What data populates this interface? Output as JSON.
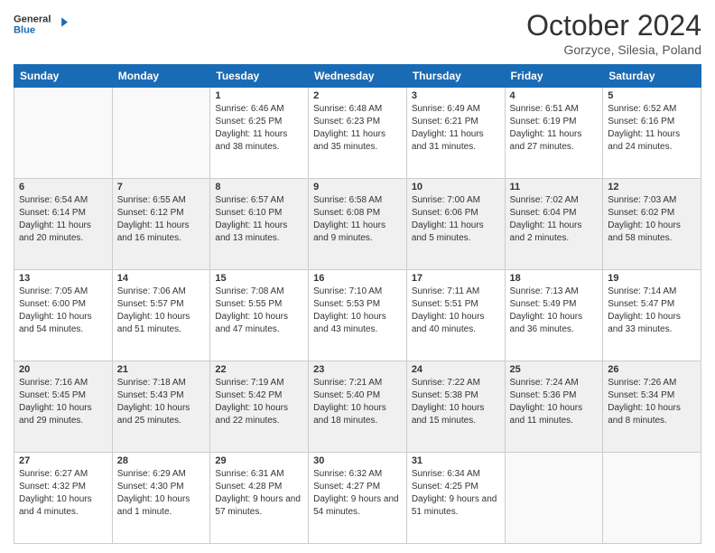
{
  "header": {
    "logo_line1": "General",
    "logo_line2": "Blue",
    "month_title": "October 2024",
    "subtitle": "Gorzyce, Silesia, Poland"
  },
  "weekdays": [
    "Sunday",
    "Monday",
    "Tuesday",
    "Wednesday",
    "Thursday",
    "Friday",
    "Saturday"
  ],
  "rows": [
    [
      {
        "day": "",
        "sunrise": "",
        "sunset": "",
        "daylight": ""
      },
      {
        "day": "",
        "sunrise": "",
        "sunset": "",
        "daylight": ""
      },
      {
        "day": "1",
        "sunrise": "Sunrise: 6:46 AM",
        "sunset": "Sunset: 6:25 PM",
        "daylight": "Daylight: 11 hours and 38 minutes."
      },
      {
        "day": "2",
        "sunrise": "Sunrise: 6:48 AM",
        "sunset": "Sunset: 6:23 PM",
        "daylight": "Daylight: 11 hours and 35 minutes."
      },
      {
        "day": "3",
        "sunrise": "Sunrise: 6:49 AM",
        "sunset": "Sunset: 6:21 PM",
        "daylight": "Daylight: 11 hours and 31 minutes."
      },
      {
        "day": "4",
        "sunrise": "Sunrise: 6:51 AM",
        "sunset": "Sunset: 6:19 PM",
        "daylight": "Daylight: 11 hours and 27 minutes."
      },
      {
        "day": "5",
        "sunrise": "Sunrise: 6:52 AM",
        "sunset": "Sunset: 6:16 PM",
        "daylight": "Daylight: 11 hours and 24 minutes."
      }
    ],
    [
      {
        "day": "6",
        "sunrise": "Sunrise: 6:54 AM",
        "sunset": "Sunset: 6:14 PM",
        "daylight": "Daylight: 11 hours and 20 minutes."
      },
      {
        "day": "7",
        "sunrise": "Sunrise: 6:55 AM",
        "sunset": "Sunset: 6:12 PM",
        "daylight": "Daylight: 11 hours and 16 minutes."
      },
      {
        "day": "8",
        "sunrise": "Sunrise: 6:57 AM",
        "sunset": "Sunset: 6:10 PM",
        "daylight": "Daylight: 11 hours and 13 minutes."
      },
      {
        "day": "9",
        "sunrise": "Sunrise: 6:58 AM",
        "sunset": "Sunset: 6:08 PM",
        "daylight": "Daylight: 11 hours and 9 minutes."
      },
      {
        "day": "10",
        "sunrise": "Sunrise: 7:00 AM",
        "sunset": "Sunset: 6:06 PM",
        "daylight": "Daylight: 11 hours and 5 minutes."
      },
      {
        "day": "11",
        "sunrise": "Sunrise: 7:02 AM",
        "sunset": "Sunset: 6:04 PM",
        "daylight": "Daylight: 11 hours and 2 minutes."
      },
      {
        "day": "12",
        "sunrise": "Sunrise: 7:03 AM",
        "sunset": "Sunset: 6:02 PM",
        "daylight": "Daylight: 10 hours and 58 minutes."
      }
    ],
    [
      {
        "day": "13",
        "sunrise": "Sunrise: 7:05 AM",
        "sunset": "Sunset: 6:00 PM",
        "daylight": "Daylight: 10 hours and 54 minutes."
      },
      {
        "day": "14",
        "sunrise": "Sunrise: 7:06 AM",
        "sunset": "Sunset: 5:57 PM",
        "daylight": "Daylight: 10 hours and 51 minutes."
      },
      {
        "day": "15",
        "sunrise": "Sunrise: 7:08 AM",
        "sunset": "Sunset: 5:55 PM",
        "daylight": "Daylight: 10 hours and 47 minutes."
      },
      {
        "day": "16",
        "sunrise": "Sunrise: 7:10 AM",
        "sunset": "Sunset: 5:53 PM",
        "daylight": "Daylight: 10 hours and 43 minutes."
      },
      {
        "day": "17",
        "sunrise": "Sunrise: 7:11 AM",
        "sunset": "Sunset: 5:51 PM",
        "daylight": "Daylight: 10 hours and 40 minutes."
      },
      {
        "day": "18",
        "sunrise": "Sunrise: 7:13 AM",
        "sunset": "Sunset: 5:49 PM",
        "daylight": "Daylight: 10 hours and 36 minutes."
      },
      {
        "day": "19",
        "sunrise": "Sunrise: 7:14 AM",
        "sunset": "Sunset: 5:47 PM",
        "daylight": "Daylight: 10 hours and 33 minutes."
      }
    ],
    [
      {
        "day": "20",
        "sunrise": "Sunrise: 7:16 AM",
        "sunset": "Sunset: 5:45 PM",
        "daylight": "Daylight: 10 hours and 29 minutes."
      },
      {
        "day": "21",
        "sunrise": "Sunrise: 7:18 AM",
        "sunset": "Sunset: 5:43 PM",
        "daylight": "Daylight: 10 hours and 25 minutes."
      },
      {
        "day": "22",
        "sunrise": "Sunrise: 7:19 AM",
        "sunset": "Sunset: 5:42 PM",
        "daylight": "Daylight: 10 hours and 22 minutes."
      },
      {
        "day": "23",
        "sunrise": "Sunrise: 7:21 AM",
        "sunset": "Sunset: 5:40 PM",
        "daylight": "Daylight: 10 hours and 18 minutes."
      },
      {
        "day": "24",
        "sunrise": "Sunrise: 7:22 AM",
        "sunset": "Sunset: 5:38 PM",
        "daylight": "Daylight: 10 hours and 15 minutes."
      },
      {
        "day": "25",
        "sunrise": "Sunrise: 7:24 AM",
        "sunset": "Sunset: 5:36 PM",
        "daylight": "Daylight: 10 hours and 11 minutes."
      },
      {
        "day": "26",
        "sunrise": "Sunrise: 7:26 AM",
        "sunset": "Sunset: 5:34 PM",
        "daylight": "Daylight: 10 hours and 8 minutes."
      }
    ],
    [
      {
        "day": "27",
        "sunrise": "Sunrise: 6:27 AM",
        "sunset": "Sunset: 4:32 PM",
        "daylight": "Daylight: 10 hours and 4 minutes."
      },
      {
        "day": "28",
        "sunrise": "Sunrise: 6:29 AM",
        "sunset": "Sunset: 4:30 PM",
        "daylight": "Daylight: 10 hours and 1 minute."
      },
      {
        "day": "29",
        "sunrise": "Sunrise: 6:31 AM",
        "sunset": "Sunset: 4:28 PM",
        "daylight": "Daylight: 9 hours and 57 minutes."
      },
      {
        "day": "30",
        "sunrise": "Sunrise: 6:32 AM",
        "sunset": "Sunset: 4:27 PM",
        "daylight": "Daylight: 9 hours and 54 minutes."
      },
      {
        "day": "31",
        "sunrise": "Sunrise: 6:34 AM",
        "sunset": "Sunset: 4:25 PM",
        "daylight": "Daylight: 9 hours and 51 minutes."
      },
      {
        "day": "",
        "sunrise": "",
        "sunset": "",
        "daylight": ""
      },
      {
        "day": "",
        "sunrise": "",
        "sunset": "",
        "daylight": ""
      }
    ]
  ]
}
